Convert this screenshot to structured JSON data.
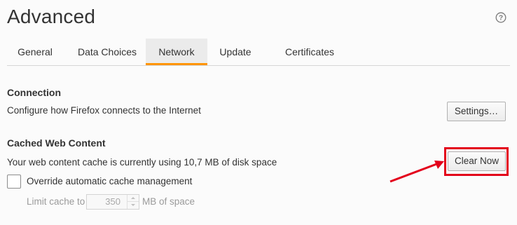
{
  "page": {
    "title": "Advanced",
    "help_icon": "question-circle-icon"
  },
  "tabs": [
    {
      "label": "General",
      "selected": false
    },
    {
      "label": "Data Choices",
      "selected": false
    },
    {
      "label": "Network",
      "selected": true
    },
    {
      "label": "Update",
      "selected": false
    },
    {
      "label": "Certificates",
      "selected": false
    }
  ],
  "connection": {
    "heading": "Connection",
    "description": "Configure how Firefox connects to the Internet",
    "settings_button": "Settings…"
  },
  "cache": {
    "heading": "Cached Web Content",
    "status": "Your web content cache is currently using 10,7 MB of disk space",
    "clear_button": "Clear Now",
    "override_label": "Override automatic cache management",
    "override_checked": false,
    "limit_label": "Limit cache to",
    "limit_value": "350",
    "limit_unit": "MB of space"
  },
  "colors": {
    "accent_tab": "#ff9500",
    "annotation": "#e3001b"
  }
}
